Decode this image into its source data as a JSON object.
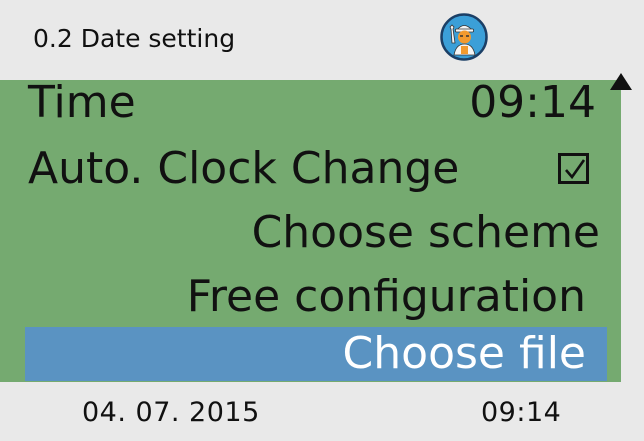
{
  "header": {
    "title": "0.2 Date setting",
    "avatar_icon": "technician-avatar-icon"
  },
  "menu": {
    "time_label": "Time",
    "time_value": "09:14",
    "auto_clock_change_label": "Auto. Clock Change",
    "auto_clock_change_checked": true,
    "choose_scheme_label": "Choose scheme",
    "free_configuration_label": "Free configuration",
    "choose_file_label": "Choose file",
    "selected_item": "Choose file",
    "scroll_indicator": "up-arrow-icon"
  },
  "footer": {
    "date": "04. 07. 2015",
    "time": "09:14"
  },
  "colors": {
    "background": "#e9e9e9",
    "menu_background": "#75aa70",
    "selection": "#5a93c2",
    "avatar_blue": "#3b9fd8",
    "avatar_orange": "#f29a2e"
  }
}
